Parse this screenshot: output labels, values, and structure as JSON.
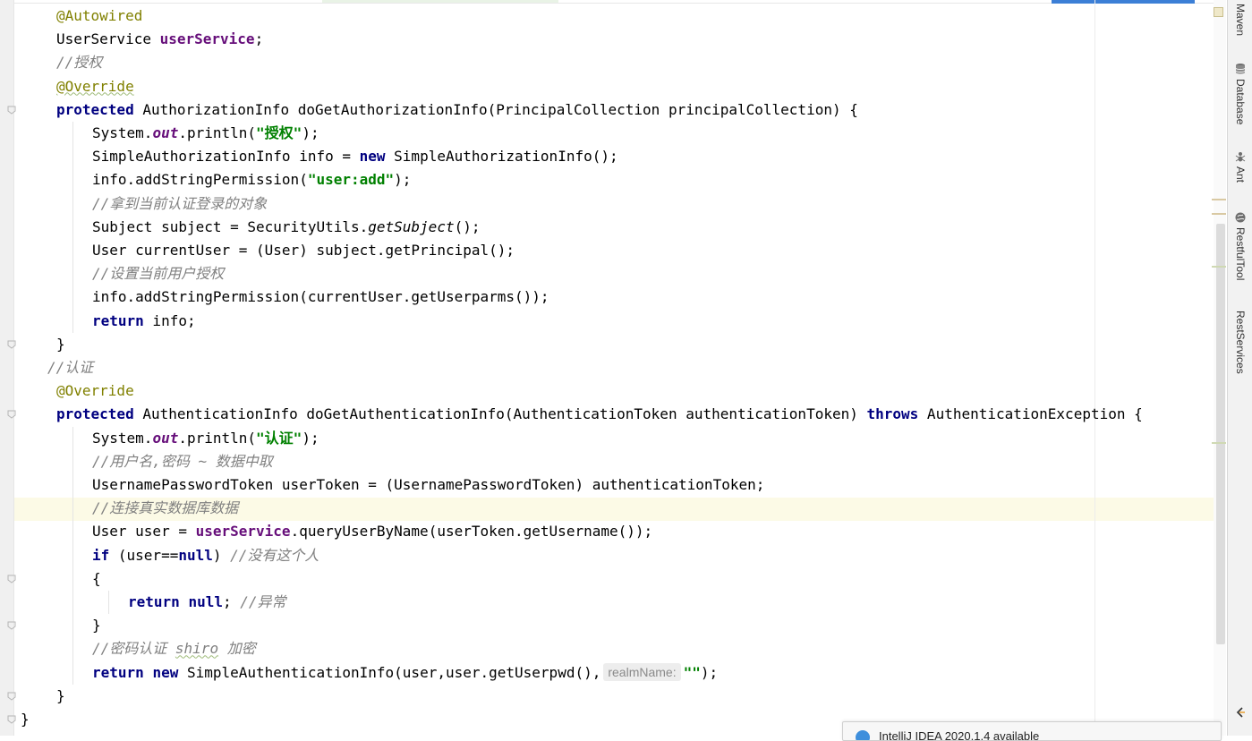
{
  "editor": {
    "lines": [
      {
        "indent": 1,
        "tokens": [
          {
            "t": "@Autowired",
            "c": "ann"
          }
        ]
      },
      {
        "indent": 1,
        "tokens": [
          {
            "t": "UserService "
          },
          {
            "t": "userService",
            "c": "fld"
          },
          {
            "t": ";"
          }
        ]
      },
      {
        "indent": 1,
        "tokens": [
          {
            "t": "//授权",
            "c": "cm"
          }
        ]
      },
      {
        "indent": 1,
        "tokens": [
          {
            "t": "@Override",
            "c": "ann wavy"
          }
        ]
      },
      {
        "indent": 1,
        "tokens": [
          {
            "t": "protected",
            "c": "kw"
          },
          {
            "t": " AuthorizationInfo doGetAuthorizationInfo(PrincipalCollection principalCollection) {"
          }
        ]
      },
      {
        "indent": 2,
        "tokens": [
          {
            "t": "System."
          },
          {
            "t": "out",
            "c": "sfld"
          },
          {
            "t": ".println("
          },
          {
            "t": "\"授权\"",
            "c": "str"
          },
          {
            "t": ");"
          }
        ]
      },
      {
        "indent": 2,
        "tokens": [
          {
            "t": "SimpleAuthorizationInfo info = "
          },
          {
            "t": "new",
            "c": "kw"
          },
          {
            "t": " SimpleAuthorizationInfo();"
          }
        ]
      },
      {
        "indent": 2,
        "tokens": [
          {
            "t": "info.addStringPermission("
          },
          {
            "t": "\"user:add\"",
            "c": "str"
          },
          {
            "t": ");"
          }
        ]
      },
      {
        "indent": 2,
        "tokens": [
          {
            "t": "//拿到当前认证登录的对象",
            "c": "cm"
          }
        ]
      },
      {
        "indent": 2,
        "tokens": [
          {
            "t": "Subject subject = SecurityUtils."
          },
          {
            "t": "getSubject",
            "c": "smth"
          },
          {
            "t": "();"
          }
        ]
      },
      {
        "indent": 2,
        "tokens": [
          {
            "t": "User currentUser = (User) subject.getPrincipal();"
          }
        ]
      },
      {
        "indent": 2,
        "tokens": [
          {
            "t": "//设置当前用户授权",
            "c": "cm"
          }
        ]
      },
      {
        "indent": 2,
        "tokens": [
          {
            "t": "info.addStringPermission(currentUser.getUserparms());"
          }
        ]
      },
      {
        "indent": 2,
        "tokens": [
          {
            "t": "return",
            "c": "kw"
          },
          {
            "t": " info;"
          }
        ]
      },
      {
        "indent": 1,
        "tokens": [
          {
            "t": "}"
          }
        ]
      },
      {
        "indent": 0.75,
        "tokens": [
          {
            "t": "//认证",
            "c": "cm"
          }
        ]
      },
      {
        "indent": 1,
        "tokens": [
          {
            "t": "@Override",
            "c": "ann"
          }
        ]
      },
      {
        "indent": 1,
        "tokens": [
          {
            "t": "protected",
            "c": "kw"
          },
          {
            "t": " AuthenticationInfo doGetAuthenticationInfo(AuthenticationToken authenticationToken) "
          },
          {
            "t": "throws",
            "c": "kw"
          },
          {
            "t": " AuthenticationException {"
          }
        ]
      },
      {
        "indent": 2,
        "tokens": [
          {
            "t": "System."
          },
          {
            "t": "out",
            "c": "sfld"
          },
          {
            "t": ".println("
          },
          {
            "t": "\"认证\"",
            "c": "str"
          },
          {
            "t": ");"
          }
        ]
      },
      {
        "indent": 2,
        "tokens": [
          {
            "t": "//用户名,密码 ~ 数据中取",
            "c": "cm"
          }
        ]
      },
      {
        "indent": 2,
        "tokens": [
          {
            "t": "UsernamePasswordToken userToken = (UsernamePasswordToken) authenticationToken;"
          }
        ]
      },
      {
        "indent": 2,
        "tokens": [
          {
            "t": "//连接真实数据库数据",
            "c": "cm"
          }
        ]
      },
      {
        "indent": 2,
        "tokens": [
          {
            "t": "User user = "
          },
          {
            "t": "userService",
            "c": "fld"
          },
          {
            "t": ".queryUserByName(userToken.getUsername());"
          }
        ]
      },
      {
        "indent": 2,
        "tokens": [
          {
            "t": "if",
            "c": "kw"
          },
          {
            "t": " (user=="
          },
          {
            "t": "null",
            "c": "kw"
          },
          {
            "t": ") "
          },
          {
            "t": "//没有这个人",
            "c": "cm"
          }
        ]
      },
      {
        "indent": 2,
        "tokens": [
          {
            "t": "{"
          }
        ]
      },
      {
        "indent": 3,
        "tokens": [
          {
            "t": "return",
            "c": "kw"
          },
          {
            "t": " "
          },
          {
            "t": "null",
            "c": "kw"
          },
          {
            "t": "; "
          },
          {
            "t": "//异常",
            "c": "cm"
          }
        ]
      },
      {
        "indent": 2,
        "tokens": [
          {
            "t": "}"
          }
        ]
      },
      {
        "indent": 2,
        "tokens": [
          {
            "t": "//密码认证 ",
            "c": "cm"
          },
          {
            "t": "shiro",
            "c": "cm wavy"
          },
          {
            "t": " 加密",
            "c": "cm"
          }
        ]
      },
      {
        "indent": 2,
        "tokens": [
          {
            "t": "return",
            "c": "kw"
          },
          {
            "t": " "
          },
          {
            "t": "new",
            "c": "kw"
          },
          {
            "t": " SimpleAuthenticationInfo(user,user.getUserpwd(),"
          },
          {
            "t": "realmName:",
            "c": "hint"
          },
          {
            "t": "\"\"",
            "c": "str"
          },
          {
            "t": ");"
          }
        ]
      },
      {
        "indent": 1,
        "tokens": [
          {
            "t": "}"
          }
        ]
      },
      {
        "indent": 0,
        "tokens": [
          {
            "t": "}"
          }
        ]
      }
    ]
  },
  "toolwindows": [
    {
      "label": "Maven",
      "icon": "maven-icon"
    },
    {
      "label": "Database",
      "icon": "database-icon"
    },
    {
      "label": "Ant",
      "icon": "ant-icon"
    },
    {
      "label": "RestfulTool",
      "icon": "globe-icon"
    },
    {
      "label": "RestServices",
      "icon": ""
    }
  ],
  "notification": {
    "icon": "info-icon",
    "text": "IntelliJ IDEA 2020.1.4 available"
  },
  "colors": {
    "keyword": "#000080",
    "string": "#008000",
    "annotation": "#808000",
    "comment": "#808080",
    "field": "#660e7a",
    "current_line": "#fcfae6"
  }
}
